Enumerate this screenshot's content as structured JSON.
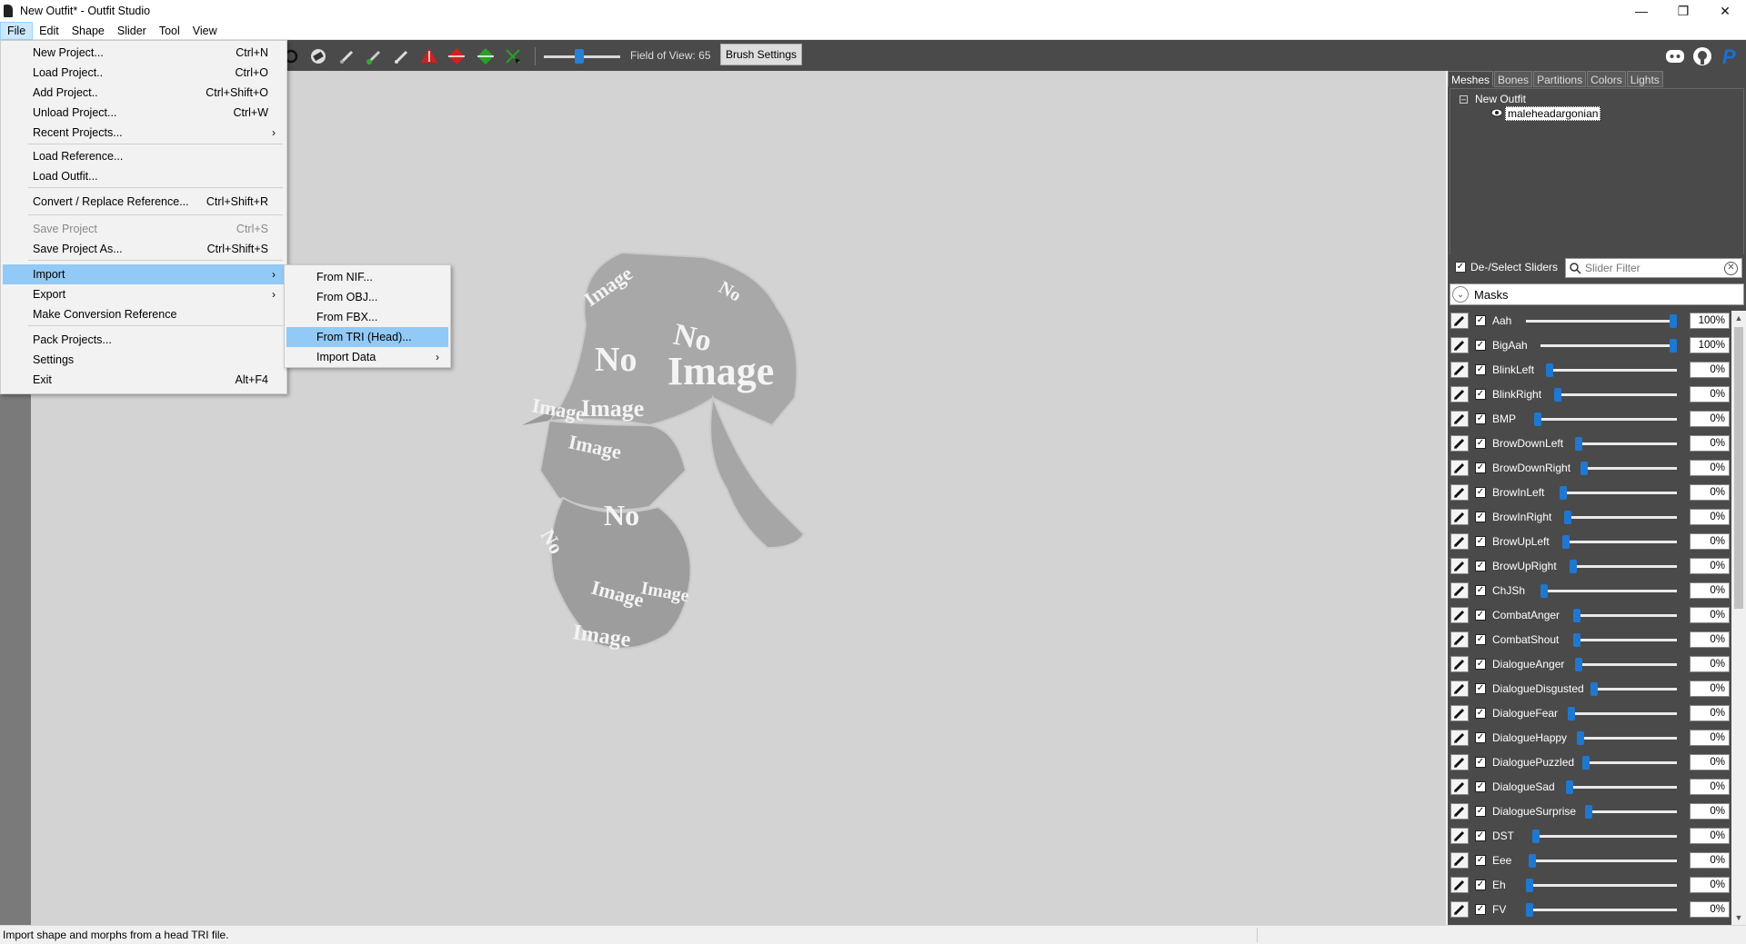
{
  "window": {
    "title": "New Outfit* - Outfit Studio",
    "controls": [
      "minimize-icon",
      "restore-icon",
      "close-icon"
    ]
  },
  "menubar": [
    "File",
    "Edit",
    "Shape",
    "Slider",
    "Tool",
    "View"
  ],
  "toolbar": {
    "fov_label": "Field of View: 65",
    "fov_value": 65,
    "brush_settings": "Brush Settings",
    "tool_icons": [
      "move-icon",
      "eraser-icon",
      "brush-icon",
      "inflate-icon",
      "smooth-icon",
      "red-arrow-icon",
      "red-diamond-icon",
      "green-diamond-icon",
      "transform-icon"
    ],
    "right_icons": [
      "discord-icon",
      "github-icon",
      "paypal-icon"
    ]
  },
  "file_menu": [
    {
      "label": "New Project...",
      "accel": "Ctrl+N"
    },
    {
      "label": "Load Project..",
      "accel": "Ctrl+O"
    },
    {
      "label": "Add Project..",
      "accel": "Ctrl+Shift+O"
    },
    {
      "label": "Unload Project...",
      "accel": "Ctrl+W"
    },
    {
      "label": "Recent Projects...",
      "accel": "",
      "submenu": true
    },
    {
      "label": "Load Reference...",
      "accel": ""
    },
    {
      "label": "Load Outfit...",
      "accel": ""
    },
    {
      "label": "Convert / Replace Reference...",
      "accel": "Ctrl+Shift+R"
    },
    {
      "label": "Save Project",
      "accel": "Ctrl+S",
      "disabled": true
    },
    {
      "label": "Save Project As...",
      "accel": "Ctrl+Shift+S"
    },
    {
      "label": "Import",
      "accel": "",
      "submenu": true,
      "highlighted": true
    },
    {
      "label": "Export",
      "accel": "",
      "submenu": true
    },
    {
      "label": "Make Conversion Reference",
      "accel": ""
    },
    {
      "label": "Pack Projects...",
      "accel": ""
    },
    {
      "label": "Settings",
      "accel": ""
    },
    {
      "label": "Exit",
      "accel": "Alt+F4"
    }
  ],
  "import_menu": [
    {
      "label": "From NIF..."
    },
    {
      "label": "From OBJ..."
    },
    {
      "label": "From FBX..."
    },
    {
      "label": "From TRI (Head)...",
      "highlighted": true
    },
    {
      "label": "Import Data",
      "submenu": true
    }
  ],
  "panel": {
    "tabs": [
      "Meshes",
      "Bones",
      "Partitions",
      "Colors",
      "Lights"
    ],
    "active_tab": "Meshes",
    "tree": {
      "root": "New Outfit",
      "child": "maleheadargonian"
    },
    "deselect_label": "De-/Select Sliders",
    "filter_placeholder": "Slider Filter",
    "masks_label": "Masks"
  },
  "sliders": [
    {
      "name": "Aah",
      "value": "100%",
      "level": 1.0
    },
    {
      "name": "BigAah",
      "value": "100%",
      "level": 1.0
    },
    {
      "name": "BlinkLeft",
      "value": "0%",
      "level": 0
    },
    {
      "name": "BlinkRight",
      "value": "0%",
      "level": 0
    },
    {
      "name": "BMP",
      "value": "0%",
      "level": 0
    },
    {
      "name": "BrowDownLeft",
      "value": "0%",
      "level": 0
    },
    {
      "name": "BrowDownRight",
      "value": "0%",
      "level": 0
    },
    {
      "name": "BrowInLeft",
      "value": "0%",
      "level": 0
    },
    {
      "name": "BrowInRight",
      "value": "0%",
      "level": 0
    },
    {
      "name": "BrowUpLeft",
      "value": "0%",
      "level": 0
    },
    {
      "name": "BrowUpRight",
      "value": "0%",
      "level": 0
    },
    {
      "name": "ChJSh",
      "value": "0%",
      "level": 0
    },
    {
      "name": "CombatAnger",
      "value": "0%",
      "level": 0
    },
    {
      "name": "CombatShout",
      "value": "0%",
      "level": 0
    },
    {
      "name": "DialogueAnger",
      "value": "0%",
      "level": 0
    },
    {
      "name": "DialogueDisgusted",
      "value": "0%",
      "level": 0
    },
    {
      "name": "DialogueFear",
      "value": "0%",
      "level": 0
    },
    {
      "name": "DialogueHappy",
      "value": "0%",
      "level": 0
    },
    {
      "name": "DialoguePuzzled",
      "value": "0%",
      "level": 0
    },
    {
      "name": "DialogueSad",
      "value": "0%",
      "level": 0
    },
    {
      "name": "DialogueSurprise",
      "value": "0%",
      "level": 0
    },
    {
      "name": "DST",
      "value": "0%",
      "level": 0
    },
    {
      "name": "Eee",
      "value": "0%",
      "level": 0
    },
    {
      "name": "Eh",
      "value": "0%",
      "level": 0
    },
    {
      "name": "FV",
      "value": "0%",
      "level": 0
    }
  ],
  "viewport": {
    "texture_text": [
      "No",
      "Image"
    ]
  },
  "status": "Import shape and morphs from a head TRI file.",
  "colors": {
    "accent": "#1e78d2",
    "toolbar_bg": "#4a4a4a",
    "viewport_bg": "#d3d3d3",
    "menu_highlight": "#91c9f7"
  }
}
